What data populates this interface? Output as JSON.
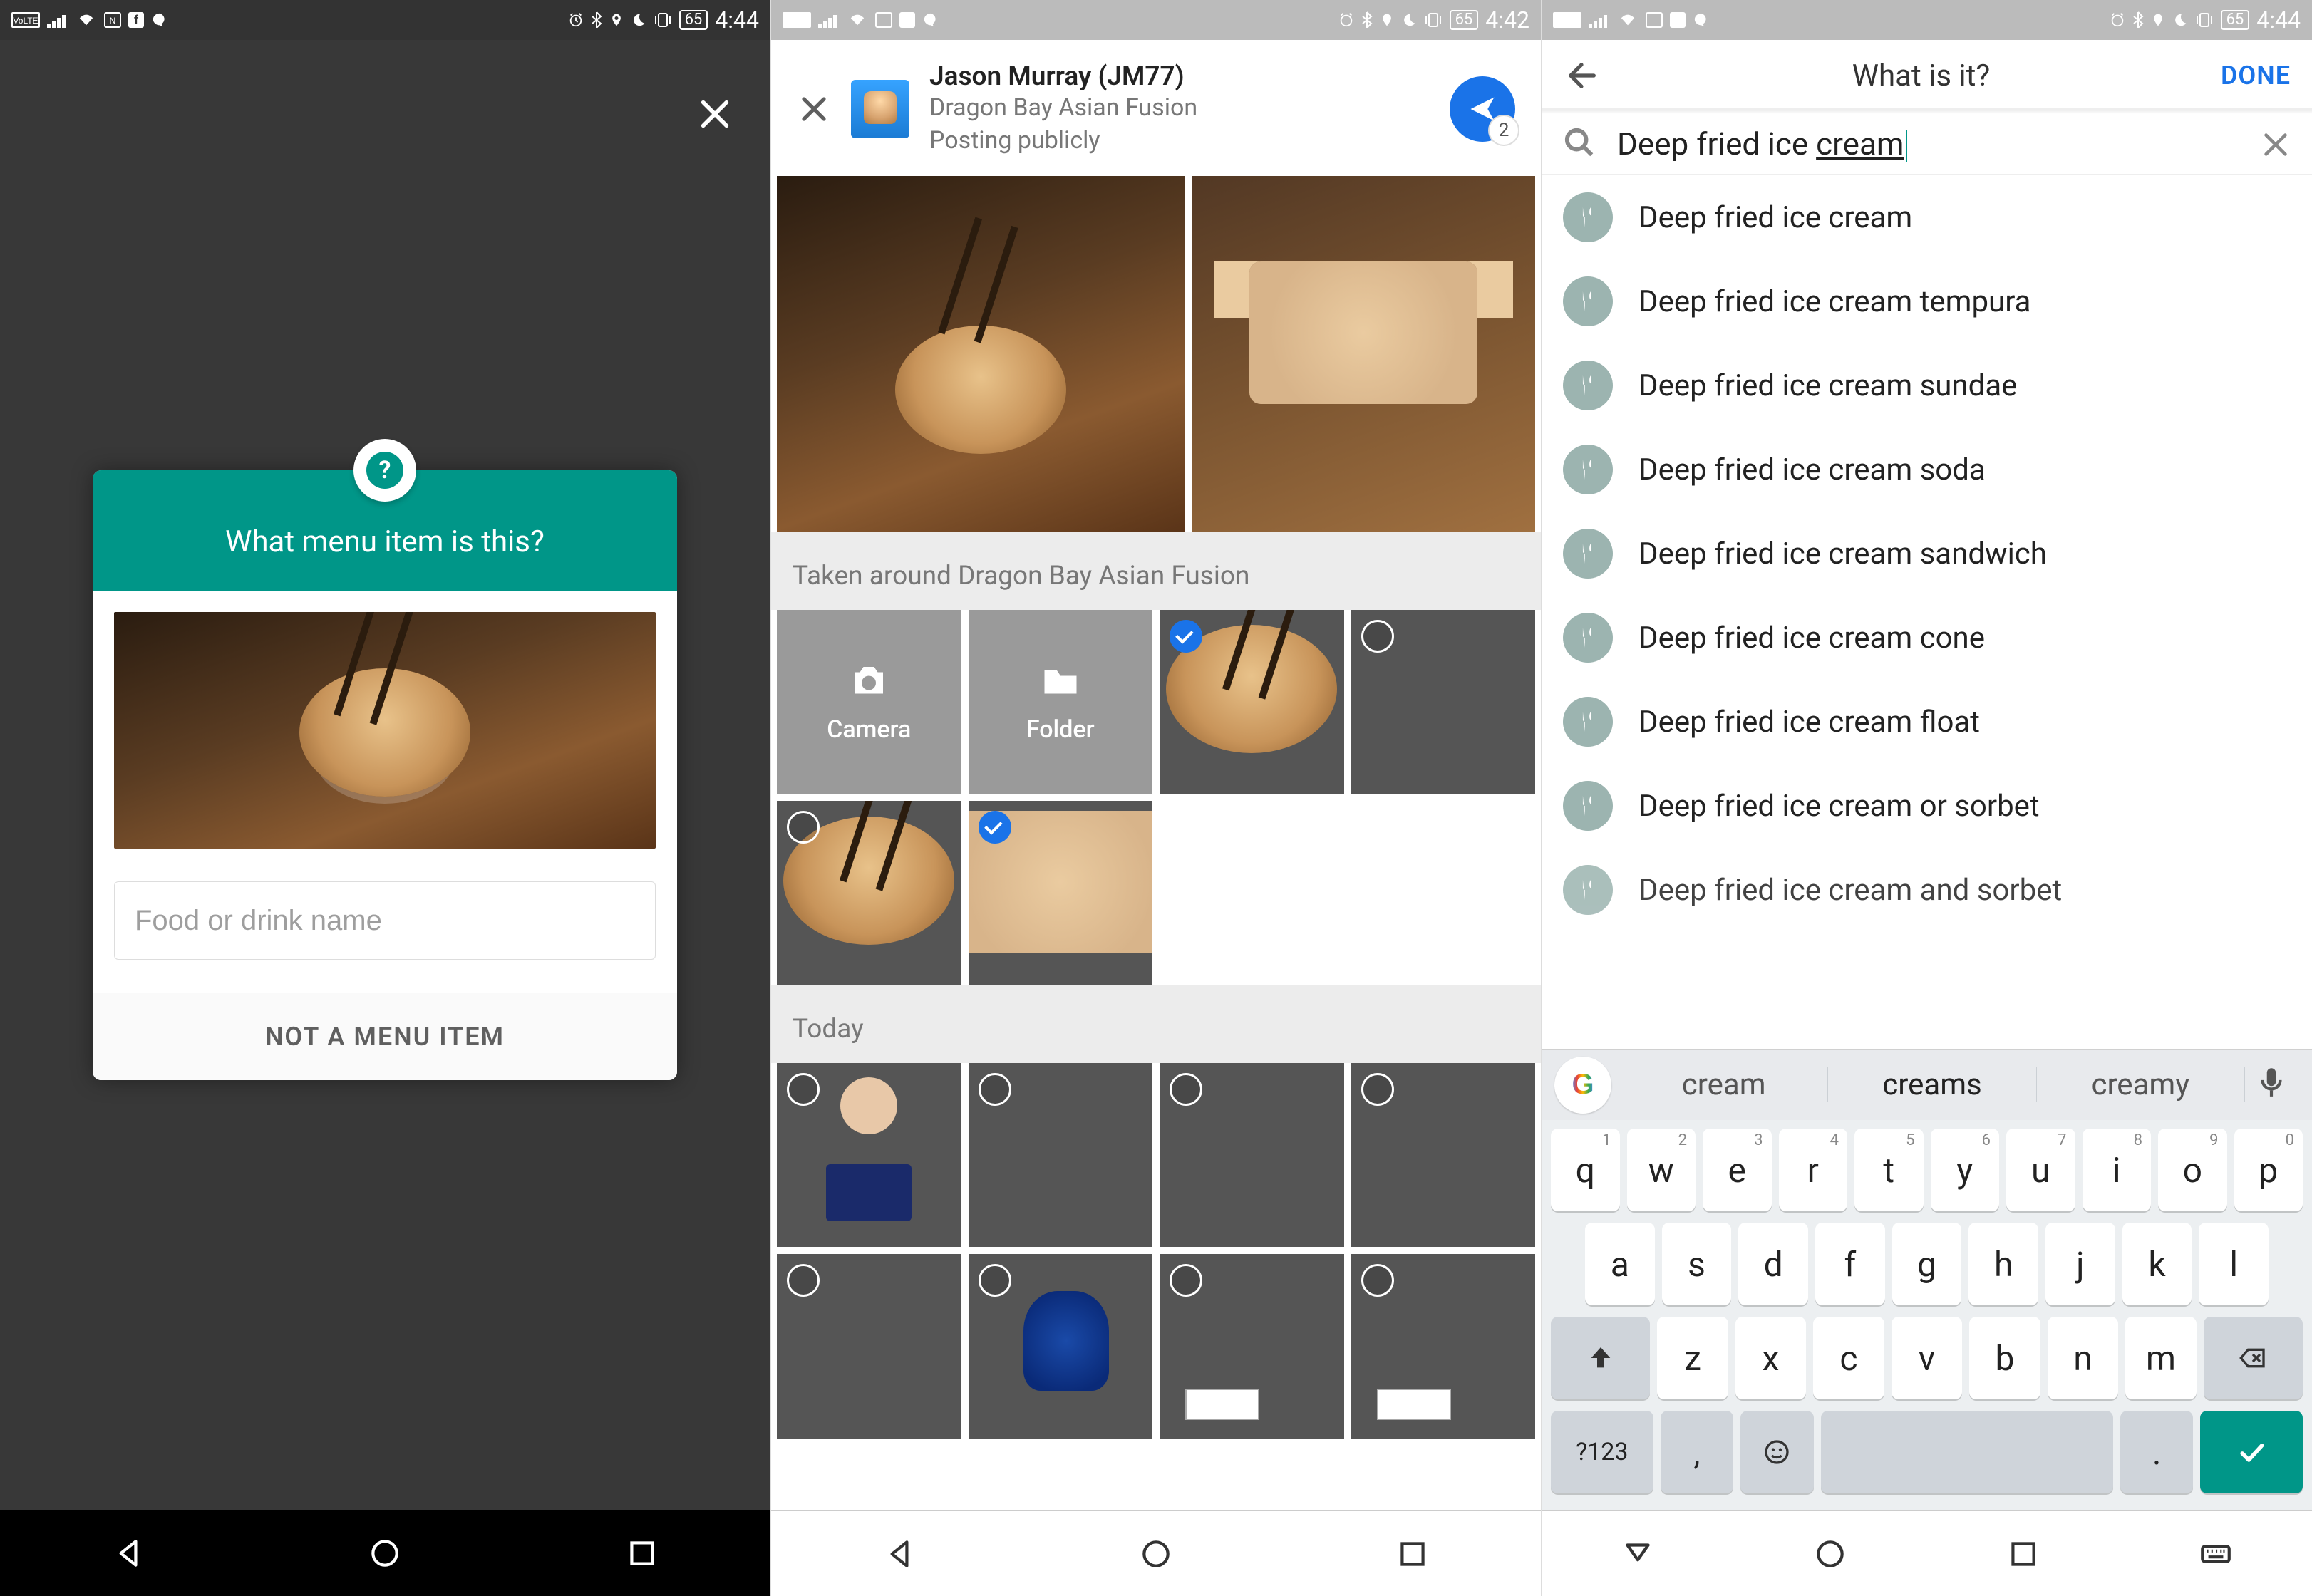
{
  "status": {
    "left_icons": [
      "volte",
      "signal",
      "wifi",
      "nfc",
      "facebook",
      "messenger"
    ],
    "right_icons": [
      "alarm",
      "bluetooth",
      "location",
      "moon",
      "vibrate"
    ],
    "battery": "65",
    "time1": "4:44",
    "time2": "4:42",
    "time3": "4:44"
  },
  "phone1": {
    "card_header": "What menu item is this?",
    "input_value": "",
    "input_placeholder": "Food or drink name",
    "footer_button": "NOT A MENU ITEM"
  },
  "phone2": {
    "user_name": "Jason Murray (JM77)",
    "place": "Dragon Bay Asian Fusion",
    "visibility": "Posting publicly",
    "send_badge": "2",
    "section1": "Taken around Dragon Bay Asian Fusion",
    "tool_camera": "Camera",
    "tool_folder": "Folder",
    "section2": "Today"
  },
  "phone3": {
    "title": "What is it?",
    "done": "DONE",
    "search_value": "Deep fried ice ",
    "search_value_ul": "cream",
    "suggestions": [
      "Deep fried ice cream",
      "Deep fried ice cream tempura",
      "Deep fried ice cream sundae",
      "Deep fried ice cream soda",
      "Deep fried ice cream sandwich",
      "Deep fried ice cream cone",
      "Deep fried ice cream float",
      "Deep fried ice cream or sorbet",
      "Deep fried ice cream and sorbet"
    ],
    "kb_suggestions": [
      "cream",
      "creams",
      "creamy"
    ],
    "symbols_label": "?123"
  }
}
